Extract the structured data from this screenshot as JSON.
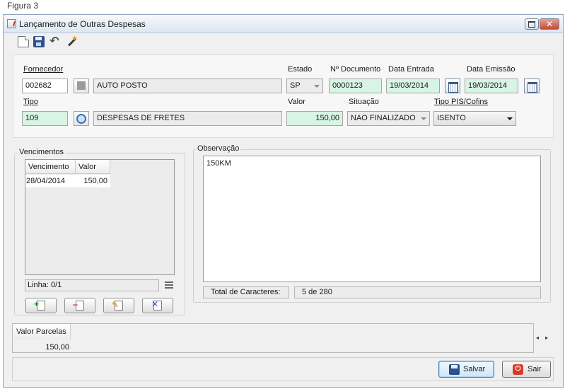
{
  "caption": "Figura 3",
  "window": {
    "title": "Lançamento de Outras Despesas",
    "close_glyph": "✕"
  },
  "toolbar": {
    "undo_glyph": "↶"
  },
  "form": {
    "fornecedor": {
      "label": "Fornecedor",
      "code": "002682",
      "name": "AUTO POSTO"
    },
    "estado": {
      "label": "Estado",
      "value": "SP"
    },
    "documento": {
      "label": "Nº Documento",
      "value": "0000123"
    },
    "data_entrada": {
      "label": "Data Entrada",
      "value": "19/03/2014"
    },
    "data_emissao": {
      "label": "Data Emissão",
      "value": "19/03/2014"
    },
    "tipo": {
      "label": "Tipo",
      "code": "109",
      "name": "DESPESAS DE FRETES"
    },
    "valor": {
      "label": "Valor",
      "value": "150,00"
    },
    "situacao": {
      "label": "Situação",
      "value": "NAO FINALIZADO"
    },
    "pis_cofins": {
      "label": "Tipo PIS/Cofins",
      "value": "ISENTO"
    }
  },
  "vencimentos": {
    "title": "Vencimentos",
    "columns": [
      "Vencimento",
      "Valor"
    ],
    "rows": [
      {
        "vencimento": "28/04/2014",
        "valor": "150,00"
      }
    ],
    "status": "Linha: 0/1",
    "buttons": {
      "add": "+",
      "remove": "−",
      "edit": "✎",
      "clear": "✕"
    }
  },
  "observacao": {
    "title": "Observação",
    "text": "150KM",
    "counter_label": "Total de Caracteres:",
    "counter_value": "5 de 280"
  },
  "parcelas": {
    "header": "Valor Parcelas",
    "value": "150,00",
    "scroll_left": "◂",
    "scroll_right": "▸"
  },
  "footer": {
    "save_label": "Salvar",
    "exit_label": "Sair",
    "exit_icon": "⏻"
  }
}
